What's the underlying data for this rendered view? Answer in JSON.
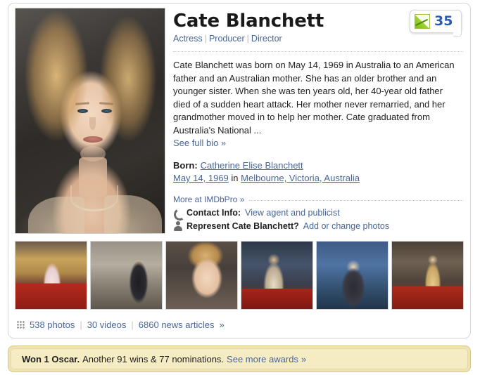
{
  "person": {
    "name": "Cate Blanchett",
    "roles": [
      "Actress",
      "Producer",
      "Director"
    ],
    "role_separator": "|",
    "star_meter": {
      "value": "35",
      "icon": "line-chart-icon",
      "accent_color": "#2a5db0",
      "chart_color": "#7ab800"
    },
    "bio": "Cate Blanchett was born on May 14, 1969 in Australia to an American father and an Australian mother. She has an older brother and an younger sister. When she was ten years old, her 40-year old father died of a sudden heart attack. Her mother never remarried, and her grandmother moved in to help her mother. Cate graduated from Australia's National ...",
    "bio_link": "See full bio »",
    "born": {
      "label": "Born:",
      "full_name": "Catherine Elise Blanchett",
      "date": "May 14, 1969",
      "in_word": "in",
      "place": "Melbourne, Victoria, Australia"
    },
    "pro": {
      "link": "More at IMDbPro »"
    },
    "contact": {
      "icon": "phone-icon",
      "label": "Contact Info:",
      "link": "View agent and publicist"
    },
    "represent": {
      "icon": "person-icon",
      "label": "Represent Cate Blanchett?",
      "link": "Add or change photos"
    },
    "portrait_alt": "Cate Blanchett portrait"
  },
  "thumbnails": [
    {
      "name": "thumb-red-carpet-pink-gown"
    },
    {
      "name": "thumb-kitchen-scene"
    },
    {
      "name": "thumb-closeup-portrait"
    },
    {
      "name": "thumb-gown-back-crowd"
    },
    {
      "name": "thumb-blue-backdrop"
    },
    {
      "name": "thumb-gold-gown-carpet"
    }
  ],
  "stats": {
    "icon": "grid-icon",
    "photos": "538 photos",
    "videos": "30 videos",
    "news": "6860 news articles",
    "separator": "|",
    "chevron": "»"
  },
  "awards": {
    "won": "Won 1 Oscar.",
    "detail": "Another 91 wins & 77 nominations.",
    "link": "See more awards",
    "chevron": "»",
    "background_color": "#f6ecc4",
    "border_color": "#d6c88d"
  }
}
